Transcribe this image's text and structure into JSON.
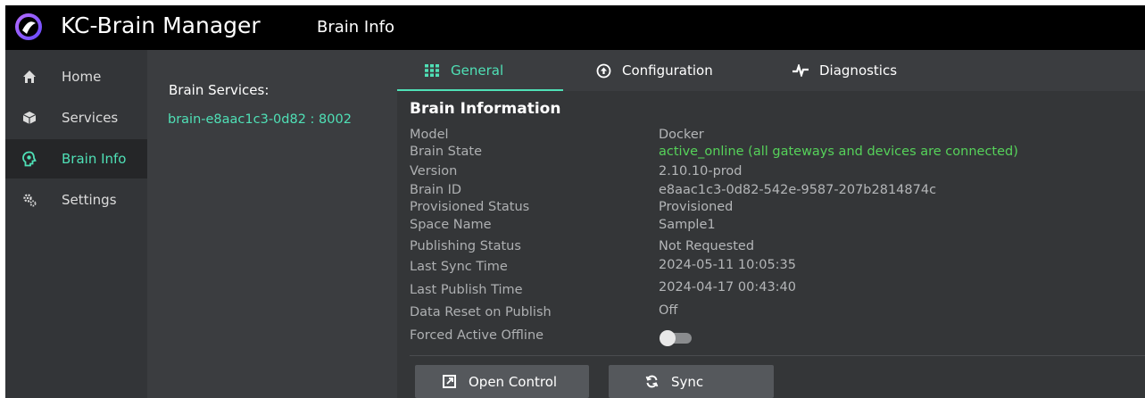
{
  "app": {
    "title": "KC-Brain Manager",
    "page_title": "Brain Info"
  },
  "sidebar": {
    "items": [
      {
        "label": "Home",
        "icon": "home-icon"
      },
      {
        "label": "Services",
        "icon": "services-icon"
      },
      {
        "label": "Brain Info",
        "icon": "brain-icon",
        "active": true
      },
      {
        "label": "Settings",
        "icon": "gears-icon"
      }
    ]
  },
  "services": {
    "heading": "Brain Services:",
    "items": [
      "brain-e8aac1c3-0d82 : 8002"
    ]
  },
  "tabs": [
    {
      "label": "General",
      "icon": "grid-icon",
      "active": true
    },
    {
      "label": "Configuration",
      "icon": "circle-arrow-icon"
    },
    {
      "label": "Diagnostics",
      "icon": "pulse-icon"
    }
  ],
  "info": {
    "title": "Brain Information",
    "rows": [
      {
        "label": "Model",
        "value": "Docker"
      },
      {
        "label": "Brain State",
        "value": "active_online (all gateways and devices  are connected)"
      },
      {
        "label": "Version",
        "value": "2.10.10-prod"
      },
      {
        "label": "Brain ID",
        "value": "e8aac1c3-0d82-542e-9587-207b2814874c"
      },
      {
        "label": "Provisioned Status",
        "value": "Provisioned"
      },
      {
        "label": "Space Name",
        "value": "Sample1"
      },
      {
        "label": "Publishing Status",
        "value": "Not Requested"
      },
      {
        "label": "Last Sync Time",
        "value": "2024-05-11  10:05:35"
      },
      {
        "label": "Last Publish Time",
        "value": "2024-04-17  00:43:40"
      },
      {
        "label": "Data Reset on Publish",
        "value": "Off"
      },
      {
        "label": "Forced Active Offline",
        "value": ""
      }
    ],
    "forced_active_offline": false
  },
  "buttons": {
    "open_control": "Open Control",
    "sync": "Sync"
  },
  "colors": {
    "accent": "#4fe0b6",
    "status_ok": "#56d25a",
    "titlebar": "#000000"
  }
}
